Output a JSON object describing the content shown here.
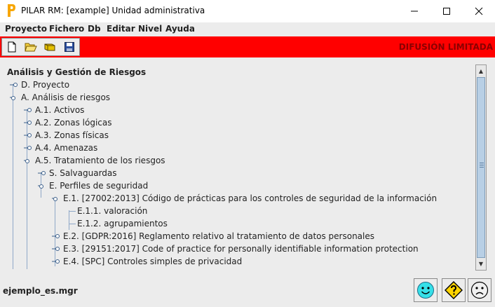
{
  "window": {
    "title": "PILAR RM: [example] Unidad administrativa",
    "controls": {
      "minimize": "–",
      "maximize": "□",
      "close": "✕"
    }
  },
  "menu": [
    "Proyecto",
    "Fichero",
    "Db",
    "Editar",
    "Nivel",
    "Ayuda"
  ],
  "toolbar": {
    "buttons": [
      "new-document-icon",
      "open-folder-icon",
      "database-icon",
      "save-disk-icon"
    ],
    "classification": "DIFUSIÓN LIMITADA",
    "background_color": "#ff0000",
    "classification_color": "#8b0000"
  },
  "tree": {
    "root": "Análisis y Gestión de Riesgos",
    "nodes": [
      "D. Proyecto",
      "A. Análisis de riesgos",
      "A.1. Activos",
      "A.2. Zonas lógicas",
      "A.3. Zonas físicas",
      "A.4. Amenazas",
      "A.5. Tratamiento de los riesgos",
      "S. Salvaguardas",
      "E. Perfiles de seguridad",
      "E.1. [27002:2013] Código de prácticas para los controles de seguridad de la información",
      "E.1.1. valoración",
      "E.1.2. agrupamientos",
      "E.2. [GDPR:2016] Reglamento relativo al tratamiento de datos personales",
      "E.3. [29151:2017] Code of practice for personally identifiable information protection",
      "E.4. [SPC] Controles simples de privacidad"
    ]
  },
  "scrollbar": {
    "up_arrow": "▲",
    "down_arrow": "▼"
  },
  "status": {
    "filename": "ejemplo_es.mgr",
    "buttons": [
      "happy-face-icon",
      "warning-question-icon",
      "sad-face-icon"
    ]
  }
}
